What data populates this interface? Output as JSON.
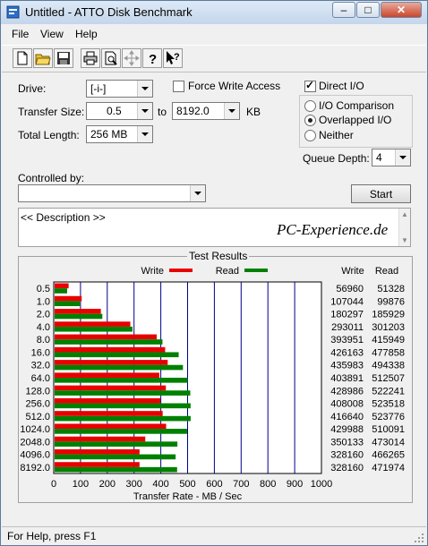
{
  "window": {
    "title": "Untitled - ATTO Disk Benchmark"
  },
  "menu": [
    "File",
    "View",
    "Help"
  ],
  "toolbar": [
    "new-icon",
    "open-icon",
    "save-icon",
    "print-icon",
    "print-preview-icon",
    "move-icon",
    "help-icon",
    "context-help-icon"
  ],
  "form": {
    "drive_label": "Drive:",
    "drive_value": "[-i-]",
    "transfer_size_label": "Transfer Size:",
    "transfer_from": "0.5",
    "transfer_to_label": "to",
    "transfer_to": "8192.0",
    "transfer_unit": "KB",
    "total_length_label": "Total Length:",
    "total_length": "256 MB",
    "force_write_label": "Force Write Access",
    "force_write_checked": false,
    "direct_io_label": "Direct I/O",
    "direct_io_checked": true,
    "io_comparison_label": "I/O Comparison",
    "overlapped_io_label": "Overlapped I/O",
    "neither_label": "Neither",
    "io_mode": "Overlapped I/O",
    "queue_depth_label": "Queue Depth:",
    "queue_depth": "4",
    "controlled_by_label": "Controlled by:",
    "controlled_by_value": "",
    "start_label": "Start",
    "description_text": "<< Description >>",
    "watermark": "PC-Experience.de"
  },
  "results": {
    "title": "Test Results",
    "legend_write": "Write",
    "legend_read": "Read",
    "col_write": "Write",
    "col_read": "Read"
  },
  "chart_data": {
    "type": "bar",
    "orientation": "horizontal",
    "title": "Test Results",
    "xlabel": "Transfer Rate - MB / Sec",
    "xlim": [
      0,
      1000
    ],
    "xticks": [
      0,
      100,
      200,
      300,
      400,
      500,
      600,
      700,
      800,
      900,
      1000
    ],
    "grid": true,
    "legend_placement": "top",
    "colors": {
      "write": "#e80000",
      "read": "#008000",
      "gridline": "#00008b"
    },
    "categories": [
      "0.5",
      "1.0",
      "2.0",
      "4.0",
      "8.0",
      "16.0",
      "32.0",
      "64.0",
      "128.0",
      "256.0",
      "512.0",
      "1024.0",
      "2048.0",
      "4096.0",
      "8192.0"
    ],
    "series": [
      {
        "name": "Write",
        "values": [
          55.6,
          104.5,
          176.1,
          286.1,
          384.7,
          416.2,
          425.7,
          394.4,
          418.9,
          398.4,
          406.9,
          419.9,
          342.0,
          320.5,
          320.5
        ]
      },
      {
        "name": "Read",
        "values": [
          50.1,
          97.5,
          181.6,
          294.1,
          406.2,
          466.7,
          482.7,
          500.5,
          510.0,
          511.2,
          511.5,
          498.1,
          461.9,
          455.3,
          460.9
        ]
      }
    ],
    "table_write": [
      "56960",
      "107044",
      "180297",
      "293011",
      "393951",
      "426163",
      "435983",
      "403891",
      "428986",
      "408008",
      "416640",
      "429988",
      "350133",
      "328160",
      "328160"
    ],
    "table_read": [
      "51328",
      "99876",
      "185929",
      "301203",
      "415949",
      "477858",
      "494338",
      "512507",
      "522241",
      "523518",
      "523776",
      "510091",
      "473014",
      "466265",
      "471974"
    ]
  },
  "status": {
    "text": "For Help, press F1"
  }
}
